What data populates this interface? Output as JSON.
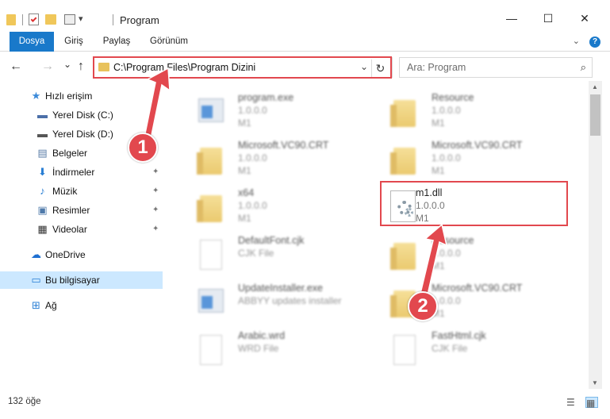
{
  "window": {
    "title": "Program",
    "minimize_glyph": "—",
    "maximize_glyph": "☐",
    "close_glyph": "✕"
  },
  "ribbon": {
    "tabs": [
      {
        "label": "Dosya",
        "active": true
      },
      {
        "label": "Giriş",
        "active": false
      },
      {
        "label": "Paylaş",
        "active": false
      },
      {
        "label": "Görünüm",
        "active": false
      }
    ],
    "help_glyph": "?",
    "expand_glyph": "⌄"
  },
  "nav": {
    "back_glyph": "←",
    "forward_glyph": "→",
    "recent_glyph": "⌄",
    "up_glyph": "↑",
    "address": "C:\\Program Files\\Program Dizini",
    "address_dropdown_glyph": "⌄",
    "refresh_glyph": "↻",
    "search_placeholder": "Ara: Program",
    "search_glyph": "⌕"
  },
  "sidebar": {
    "items": [
      {
        "label": "Hızlı erişim",
        "icon": "star-icon",
        "glyph": "★",
        "color": "#3b8ad9",
        "pinned": false
      },
      {
        "label": "Yerel Disk (C:)",
        "icon": "drive-icon",
        "glyph": "▬",
        "color": "#4b6fa8",
        "pinned": false
      },
      {
        "label": "Yerel Disk (D:)",
        "icon": "drive-icon",
        "glyph": "▬",
        "color": "#555555",
        "pinned": false
      },
      {
        "label": "Belgeler",
        "icon": "documents-icon",
        "glyph": "▤",
        "color": "#5b7ea8",
        "pinned": false
      },
      {
        "label": "İndirmeler",
        "icon": "download-icon",
        "glyph": "⬇",
        "color": "#2a7fd4",
        "pinned": true
      },
      {
        "label": "Müzik",
        "icon": "music-icon",
        "glyph": "♪",
        "color": "#2a7fd4",
        "pinned": true
      },
      {
        "label": "Resimler",
        "icon": "pictures-icon",
        "glyph": "▣",
        "color": "#4f7aaa",
        "pinned": true
      },
      {
        "label": "Videolar",
        "icon": "video-icon",
        "glyph": "▦",
        "color": "#333333",
        "pinned": true
      },
      {
        "label": "OneDrive",
        "icon": "cloud-icon",
        "glyph": "☁",
        "color": "#1e6fd1",
        "pinned": false
      },
      {
        "label": "Bu bilgisayar",
        "icon": "computer-icon",
        "glyph": "▭",
        "color": "#2a7fd4",
        "pinned": false
      },
      {
        "label": "Ağ",
        "icon": "network-icon",
        "glyph": "⊞",
        "color": "#2a7fd4",
        "pinned": false
      }
    ],
    "pin_glyph": "📌"
  },
  "files": [
    {
      "name": "program.exe",
      "sub1": "1.0.0.0",
      "sub2": "M1",
      "kind": "exe",
      "blurred": true
    },
    {
      "name": "Resource",
      "sub1": "1.0.0.0",
      "sub2": "M1",
      "kind": "folder",
      "blurred": true
    },
    {
      "name": "Microsoft.VC90.CRT",
      "sub1": "1.0.0.0",
      "sub2": "M1",
      "kind": "folder",
      "blurred": true
    },
    {
      "name": "Microsoft.VC90.CRT",
      "sub1": "1.0.0.0",
      "sub2": "M1",
      "kind": "folder",
      "blurred": true
    },
    {
      "name": "x64",
      "sub1": "1.0.0.0",
      "sub2": "M1",
      "kind": "folder",
      "blurred": true
    },
    {
      "name": "m1.dll",
      "sub1": "1.0.0.0",
      "sub2": "M1",
      "kind": "dll",
      "blurred": false
    },
    {
      "name": "DefaultFont.cjk",
      "sub1": "CJK File",
      "sub2": "",
      "kind": "doc",
      "blurred": true
    },
    {
      "name": "Resource",
      "sub1": "1.0.0.0",
      "sub2": "M1",
      "kind": "folder",
      "blurred": true
    },
    {
      "name": "UpdateInstaller.exe",
      "sub1": "ABBYY updates installer",
      "sub2": "",
      "kind": "exe",
      "blurred": true
    },
    {
      "name": "Microsoft.VC90.CRT",
      "sub1": "1.0.0.0",
      "sub2": "M1",
      "kind": "folder",
      "blurred": true
    },
    {
      "name": "Arabic.wrd",
      "sub1": "WRD File",
      "sub2": "",
      "kind": "doc",
      "blurred": true
    },
    {
      "name": "FastHtml.cjk",
      "sub1": "CJK File",
      "sub2": "",
      "kind": "doc",
      "blurred": true
    }
  ],
  "status": {
    "count": "132 öğe"
  },
  "callouts": [
    {
      "number": "1"
    },
    {
      "number": "2"
    }
  ],
  "colors": {
    "accent": "#1979ca",
    "highlight": "#e2484e",
    "selection": "#cce8ff"
  }
}
